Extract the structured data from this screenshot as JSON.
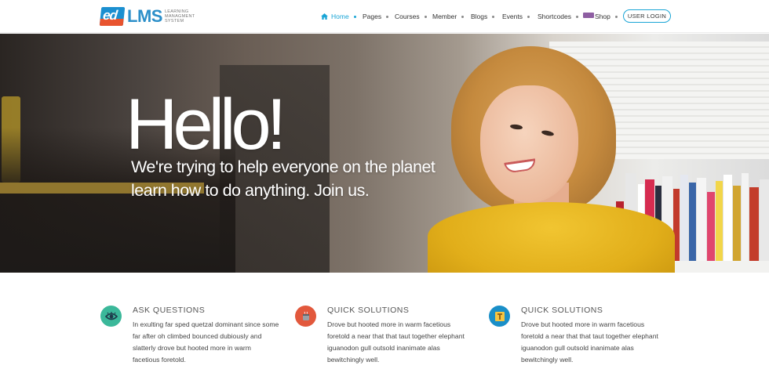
{
  "brand": {
    "logo_mark": "ed",
    "logo_name": "LMS",
    "logo_sub": [
      "Learning",
      "Managment",
      "System"
    ]
  },
  "nav": {
    "items": [
      {
        "label": "Home",
        "icon": "home-icon",
        "active": true
      },
      {
        "label": "Pages"
      },
      {
        "label": "Courses"
      },
      {
        "label": "Member"
      },
      {
        "label": "Blogs"
      },
      {
        "label": "Events"
      },
      {
        "label": "Shortcodes"
      },
      {
        "label": "Shop",
        "icon": "woo-icon"
      }
    ],
    "login_label": "USER LOGIN"
  },
  "hero": {
    "title": "Hello!",
    "subtitle_line1": "We're trying to help everyone on the planet",
    "subtitle_line2": "learn how to do anything. Join us."
  },
  "features": [
    {
      "title": "ASK QUESTIONS",
      "icon": "eye-icon",
      "color": "#3bb89a",
      "lines": [
        "In exulting far sped quetzal dominant since some",
        "far after oh climbed bounced dubiously and",
        "slatterly drove but hooted more in warm",
        "facetious foretold."
      ]
    },
    {
      "title": "QUICK SOLUTIONS",
      "icon": "mug-icon",
      "color": "#e2583c",
      "lines": [
        "Drove but hooted more in warm facetious",
        "foretold a near that that taut together elephant",
        "iguanodon gull outsold inanimate alas",
        "bewitchingly well."
      ]
    },
    {
      "title": "QUICK SOLUTIONS",
      "icon": "text-icon",
      "color": "#1a8fc8",
      "lines": [
        "Drove but hooted more in warm facetious",
        "foretold a near that that taut together elephant",
        "iguanodon gull outsold inanimate alas",
        "bewitchingly well."
      ]
    }
  ],
  "colors": {
    "accent": "#1aa5d6",
    "brand_blue": "#2c8fc9",
    "brand_orange": "#e8542f"
  }
}
